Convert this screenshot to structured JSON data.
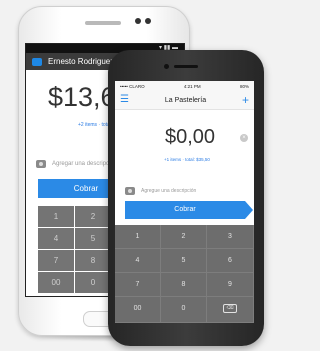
{
  "back_phone": {
    "user_name": "Ernesto Rodriguez",
    "amount": "$13,6",
    "items_text": "+2 items · total: $86",
    "description_placeholder": "Agregar una descripción",
    "charge_label": "Cobrar",
    "keys": [
      "1",
      "2",
      "4",
      "5",
      "7",
      "8",
      "00",
      "0"
    ]
  },
  "front_phone": {
    "status": {
      "carrier": "••••• CLARO",
      "time": "4:21 PM",
      "battery": "80%"
    },
    "title": "La Pastelería",
    "amount": "$0,00",
    "items_text": "+1 items · total: $35,50",
    "description_placeholder": "Agregue una descripción",
    "charge_label": "Cobrar",
    "keys": [
      "1",
      "2",
      "3",
      "4",
      "5",
      "6",
      "7",
      "8",
      "9",
      "00",
      "0",
      "⌫"
    ]
  },
  "colors": {
    "accent": "#2b8ae6",
    "keypad": "#6d6d6d"
  }
}
